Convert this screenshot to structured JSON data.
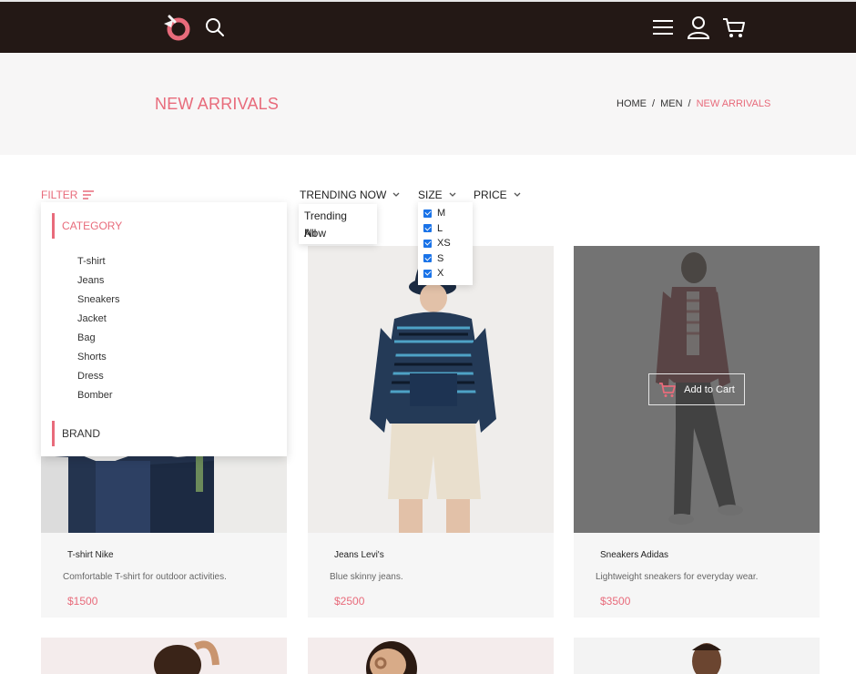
{
  "header": {
    "logo": "brand-logo",
    "icons": [
      "search-icon",
      "menu-icon",
      "user-icon",
      "cart-icon"
    ]
  },
  "page": {
    "title": "NEW ARRIVALS",
    "breadcrumb": [
      {
        "label": "HOME"
      },
      {
        "label": "MEN"
      },
      {
        "label": "NEW ARRIVALS"
      }
    ],
    "breadcrumb_sep": "/"
  },
  "filters": {
    "filter_label": "FILTER",
    "trending_label": "TRENDING NOW",
    "size_label": "SIZE",
    "price_label": "PRICE",
    "trending_options": [
      "Trending Now",
      "All"
    ],
    "size_options": [
      {
        "label": "M",
        "checked": true
      },
      {
        "label": "L",
        "checked": true
      },
      {
        "label": "XS",
        "checked": true
      },
      {
        "label": "S",
        "checked": true
      },
      {
        "label": "X",
        "checked": true
      }
    ]
  },
  "filter_panel": {
    "category_title": "CATEGORY",
    "categories": [
      "T-shirt",
      "Jeans",
      "Sneakers",
      "Jacket",
      "Bag",
      "Shorts",
      "Dress",
      "Bomber"
    ],
    "brand_title": "BRAND"
  },
  "products": [
    {
      "name": "T-shirt Nike",
      "desc": "Comfortable T-shirt for outdoor activities.",
      "price": "$1500"
    },
    {
      "name": "Jeans Levi's",
      "desc": "Blue skinny jeans.",
      "price": "$2500"
    },
    {
      "name": "Sneakers Adidas",
      "desc": "Lightweight sneakers for everyday wear.",
      "price": "$3500"
    }
  ],
  "add_to_cart_label": "Add to Cart",
  "colors": {
    "accent": "#e86b7b",
    "header_bg": "#231815",
    "checkbox": "#1a73e8"
  }
}
